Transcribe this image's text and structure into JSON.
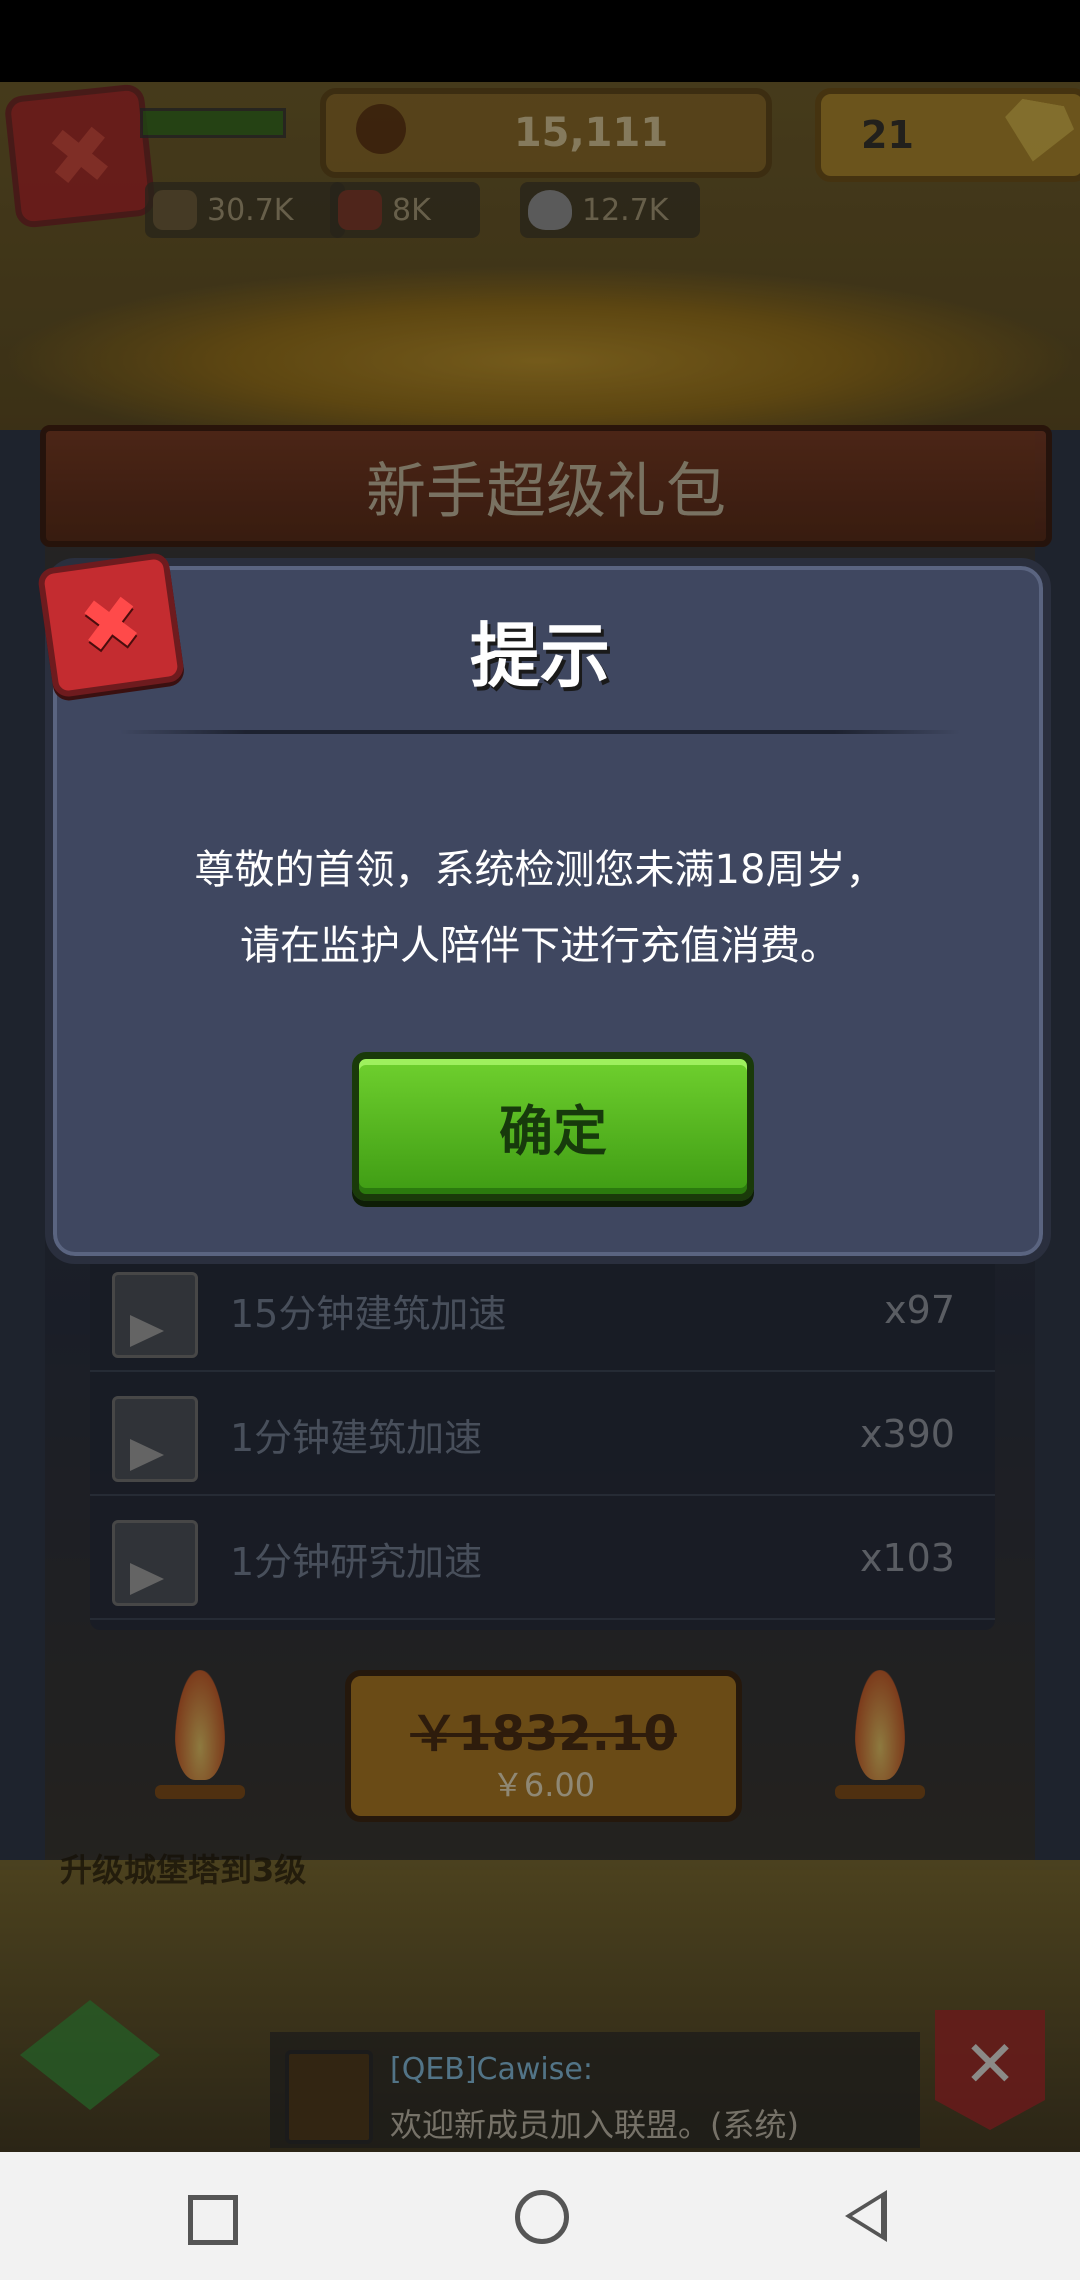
{
  "hud": {
    "power": "15,111",
    "gems": "21",
    "resources": [
      {
        "name": "wood-icon",
        "value": "30.7K"
      },
      {
        "name": "meat-icon",
        "value": "8K"
      },
      {
        "name": "stone-icon",
        "value": "12.7K"
      }
    ]
  },
  "pack": {
    "title": "新手超级礼包",
    "items": [
      {
        "label": "15分钟建筑加速",
        "count": "x97"
      },
      {
        "label": "1分钟建筑加速",
        "count": "x390"
      },
      {
        "label": "1分钟研究加速",
        "count": "x103"
      }
    ],
    "original_price": "￥1832.10",
    "price": "￥6.00"
  },
  "scene": {
    "quest": "升级城堡塔到3级"
  },
  "chat": {
    "name": "[QEB]Cawise:",
    "message": "欢迎新成员加入联盟。(系统)"
  },
  "dialog": {
    "title": "提示",
    "message_line1": "尊敬的首领，系统检测您未满18周岁，",
    "message_line2": "请在监护人陪伴下进行充值消费。",
    "confirm_label": "确定"
  }
}
